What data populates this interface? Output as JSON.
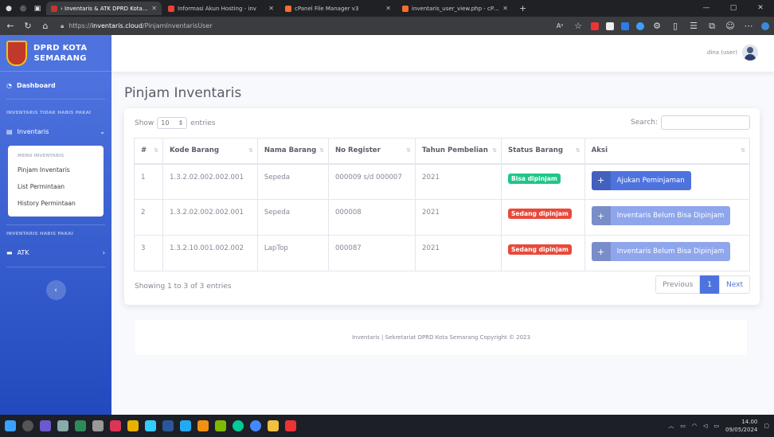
{
  "browser": {
    "tabs": [
      {
        "label": "› Inventaris & ATK DPRD Kota Se",
        "active": true,
        "color": "#c0392b"
      },
      {
        "label": "Informasi Akun Hosting - inv",
        "active": false,
        "color": "#ea4335"
      },
      {
        "label": "cPanel File Manager v3",
        "active": false,
        "color": "#ff6c2c"
      },
      {
        "label": "inventaris_user_view.php - cPane",
        "active": false,
        "color": "#ff6c2c"
      }
    ],
    "url_prefix": "https://",
    "url_host": "inventaris.cloud",
    "url_path": "/PinjamInventarisUser"
  },
  "sidebar": {
    "brand_line1": "DPRD KOTA",
    "brand_line2": "SEMARANG",
    "dashboard": "Dashboard",
    "section1": "INVENTARIS TIDAK HABIS PAKAI",
    "inventaris": "Inventaris",
    "submenu_head": "MENU INVENTARIS",
    "submenu": [
      "Pinjam Inventaris",
      "List Permintaan",
      "History Permintaan"
    ],
    "section2": "INVENTARIS HABIS PAKAI",
    "atk": "ATK"
  },
  "topbar": {
    "user": "dina (user)"
  },
  "page": {
    "title": "Pinjam Inventaris"
  },
  "table_ctrl": {
    "show": "Show",
    "length": "10",
    "entries": "entries",
    "search": "Search:"
  },
  "table": {
    "headers": [
      "#",
      "Kode Barang",
      "Nama Barang",
      "No Register",
      "Tahun Pembelian",
      "Status Barang",
      "Aksi"
    ],
    "rows": [
      {
        "no": "1",
        "kode": "1.3.2.02.002.002.001",
        "nama": "Sepeda",
        "reg": "000009 s/d 000007",
        "tahun": "2021",
        "status": "Bisa dipinjam",
        "status_color": "#1cc88a",
        "aksi": "Ajukan Peminjaman",
        "aksi_color": "#4e73df"
      },
      {
        "no": "2",
        "kode": "1.3.2.02.002.002.001",
        "nama": "Sepeda",
        "reg": "000008",
        "tahun": "2021",
        "status": "Sedang dipinjam",
        "status_color": "#e74a3b",
        "aksi": "Inventaris Belum Bisa Dipinjam",
        "aksi_color": "#8fa6ec"
      },
      {
        "no": "3",
        "kode": "1.3.2.10.001.002.002",
        "nama": "LapTop",
        "reg": "000087",
        "tahun": "2021",
        "status": "Sedang dipinjam",
        "status_color": "#e74a3b",
        "aksi": "Inventaris Belum Bisa Dipinjam",
        "aksi_color": "#8fa6ec"
      }
    ]
  },
  "table_info": "Showing 1 to 3 of 3 entries",
  "pager": {
    "prev": "Previous",
    "page": "1",
    "next": "Next"
  },
  "footer": "Inventaris | Sekretariat DPRD Kota Semarang Copyright © 2023",
  "taskbar": {
    "time": "14.00",
    "date": "09/05/2024"
  }
}
